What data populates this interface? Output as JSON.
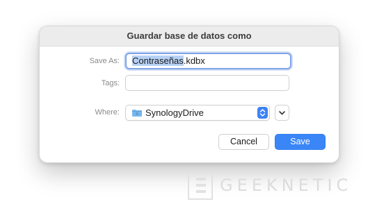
{
  "dialog": {
    "title": "Guardar base de datos como",
    "save_as": {
      "label": "Save As:",
      "value_selected": "Contraseñas",
      "value_rest": ".kdbx"
    },
    "tags": {
      "label": "Tags:",
      "value": ""
    },
    "where": {
      "label": "Where:",
      "folder_icon": "folder-icon",
      "value": "SynologyDrive"
    },
    "buttons": {
      "cancel": "Cancel",
      "save": "Save"
    }
  },
  "watermark": {
    "text": "GEEKNETIC"
  },
  "colors": {
    "accent": "#3b86f7",
    "focus_ring": "#7ea4e6",
    "selection": "#b7d1f5"
  }
}
